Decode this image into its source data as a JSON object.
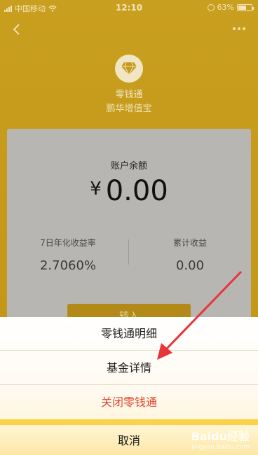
{
  "status_bar": {
    "carrier": "中国移动",
    "time": "12:10",
    "battery": "63%"
  },
  "app": {
    "title": "零钱通",
    "subtitle": "鹏华增值宝",
    "balance_label": "账户余额",
    "currency": "¥",
    "balance": "0.00",
    "stats": [
      {
        "label": "7日年化收益率",
        "value": "2.7060%"
      },
      {
        "label": "累计收益",
        "value": "0.00"
      }
    ],
    "button_label": "转入"
  },
  "sheet": {
    "items": [
      "零钱通明细",
      "基金详情",
      "关闭零钱通"
    ],
    "cancel": "取消"
  },
  "watermark": {
    "brand": "Baidu经验",
    "url": "jingyan.baidu.com"
  },
  "colors": {
    "theme": "#c99f1f",
    "danger": "#e2462f",
    "annotation_arrow": "#e8353a"
  }
}
